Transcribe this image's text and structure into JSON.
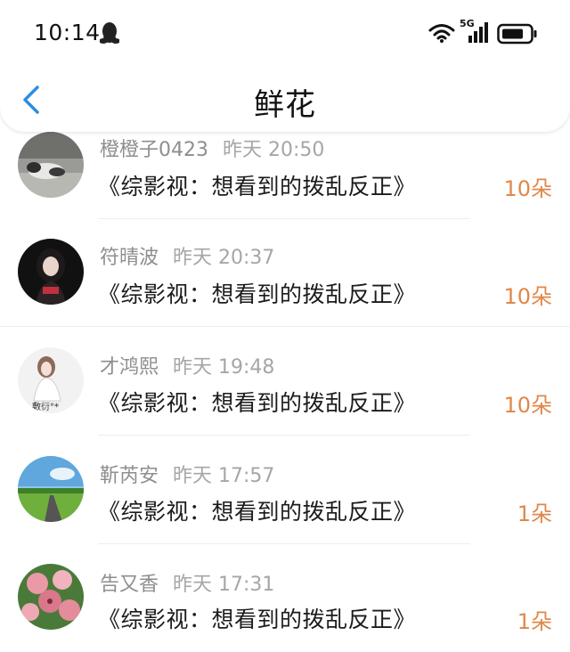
{
  "status_bar": {
    "time": "10:14",
    "network": "5G",
    "icons": [
      "qq-penguin-icon",
      "wifi-icon",
      "signal-5g-icon",
      "battery-icon"
    ]
  },
  "nav": {
    "back_icon": "chevron-left-icon",
    "title": "鲜花"
  },
  "colors": {
    "back_accent": "#2d8ee0",
    "count_accent": "#e0884a",
    "meta_gray": "#9a9a9a"
  },
  "items": [
    {
      "name": "橙橙子0423",
      "time": "昨天 20:50",
      "book": "《综影视：想看到的拨乱反正》",
      "count": "10朵"
    },
    {
      "name": "符晴波",
      "time": "昨天 20:37",
      "book": "《综影视：想看到的拨乱反正》",
      "count": "10朵"
    },
    {
      "name": "才鸿熙",
      "time": "昨天 19:48",
      "book": "《综影视：想看到的拨乱反正》",
      "count": "10朵",
      "avatar_text": "敷衍°*"
    },
    {
      "name": "靳芮安",
      "time": "昨天 17:57",
      "book": "《综影视：想看到的拨乱反正》",
      "count": "1朵"
    },
    {
      "name": "告又香",
      "time": "昨天 17:31",
      "book": "《综影视：想看到的拨乱反正》",
      "count": "1朵"
    }
  ]
}
